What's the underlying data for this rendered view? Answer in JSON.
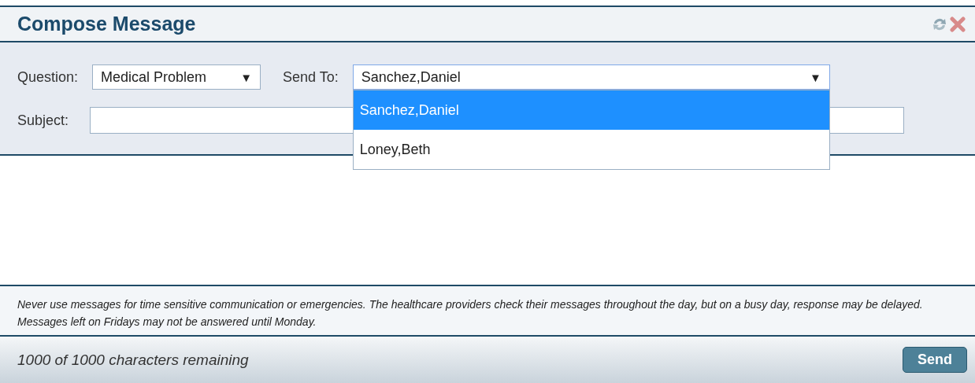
{
  "window": {
    "title": "Compose Message"
  },
  "form": {
    "question": {
      "label": "Question:",
      "value": "Medical Problem",
      "arrow": "▼"
    },
    "send_to": {
      "label": "Send To:",
      "value": "Sanchez,Daniel",
      "arrow": "▼",
      "expanded": true,
      "options": [
        {
          "label": "Sanchez,Daniel",
          "selected": true
        },
        {
          "label": "Loney,Beth",
          "selected": false
        }
      ]
    },
    "subject": {
      "label": "Subject:"
    }
  },
  "notice": "Never use messages for time sensitive communication or emergencies. The healthcare providers check their messages throughout the day, but on a busy day, response may be delayed. Messages left on Fridays may not be answered until Monday.",
  "footer": {
    "remaining": "1000 of 1000 characters remaining",
    "send": "Send"
  }
}
